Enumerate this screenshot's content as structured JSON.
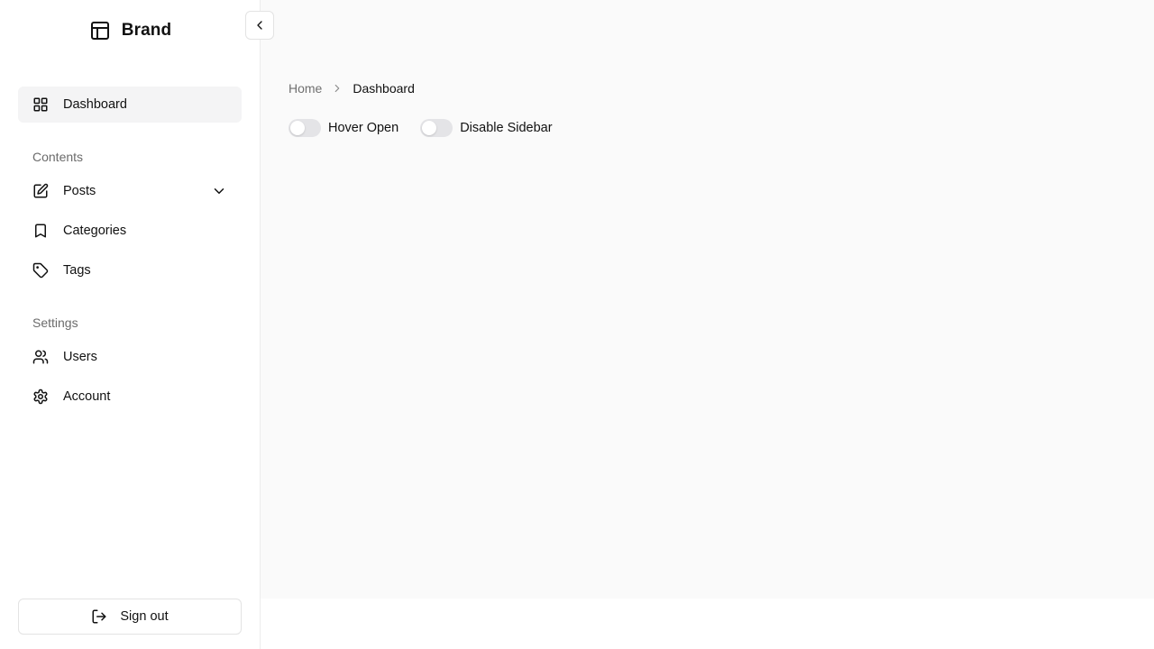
{
  "brand": {
    "name": "Brand"
  },
  "sidebar": {
    "collapse_icon": "chevron-left-icon",
    "items": [
      {
        "label": "Dashboard",
        "icon": "layout-grid-icon",
        "active": true
      },
      {
        "label": "Posts",
        "icon": "square-pen-icon",
        "has_submenu": true
      },
      {
        "label": "Categories",
        "icon": "bookmark-icon"
      },
      {
        "label": "Tags",
        "icon": "tag-icon"
      },
      {
        "label": "Users",
        "icon": "users-icon"
      },
      {
        "label": "Account",
        "icon": "settings-icon"
      }
    ],
    "groups": {
      "contents": "Contents",
      "settings": "Settings"
    },
    "signout_label": "Sign out"
  },
  "breadcrumb": {
    "home": "Home",
    "current": "Dashboard"
  },
  "toggles": [
    {
      "label": "Hover Open",
      "checked": false
    },
    {
      "label": "Disable Sidebar",
      "checked": false
    }
  ],
  "colors": {
    "main_bg": "#fafafa",
    "active_bg": "#f4f4f5",
    "switch_off": "#e4e4e7",
    "muted_text": "#6b6b6b"
  }
}
